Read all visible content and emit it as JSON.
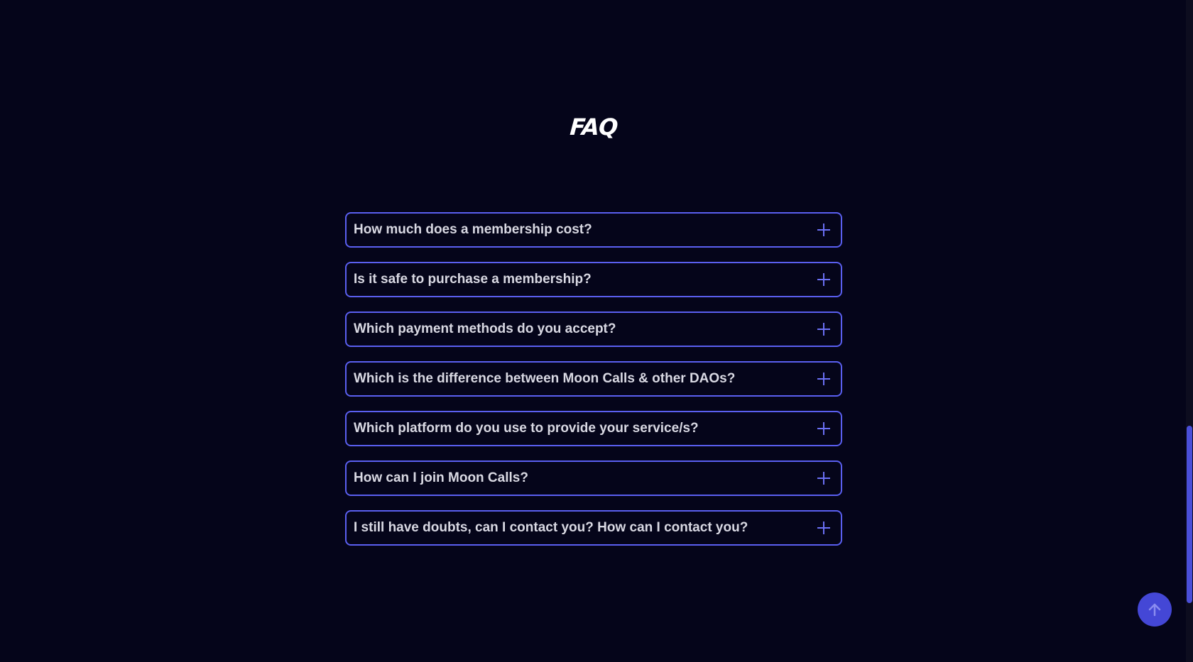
{
  "faq": {
    "title": "FAQ",
    "items": [
      {
        "question": "How much does a membership cost?"
      },
      {
        "question": "Is it safe to purchase a membership?"
      },
      {
        "question": "Which payment methods do you accept?"
      },
      {
        "question": "Which is the difference between Moon Calls & other DAOs?"
      },
      {
        "question": "Which platform do you use to provide your service/s?"
      },
      {
        "question": "How can I join Moon Calls?"
      },
      {
        "question": "I still have doubts, can I contact you? How can I contact you?"
      }
    ],
    "expand_icon": "plus-icon"
  },
  "scroll_top": {
    "icon": "arrow-up-icon"
  },
  "colors": {
    "background": "#05051a",
    "accent": "#5a5ff0",
    "button": "#4447d6",
    "question_text": "#d9d9e3"
  }
}
